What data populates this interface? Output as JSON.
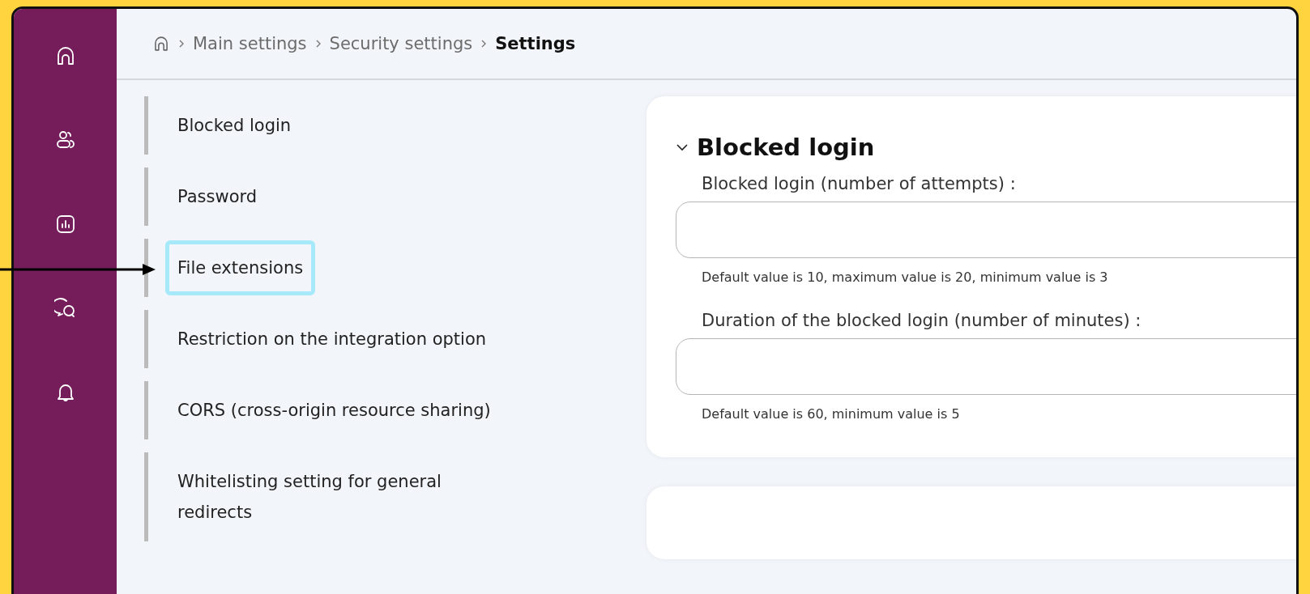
{
  "breadcrumb": [
    {
      "label": "Main settings",
      "current": false
    },
    {
      "label": "Security settings",
      "current": false
    },
    {
      "label": "Settings",
      "current": true
    }
  ],
  "nav": {
    "items": [
      {
        "label": "Blocked login",
        "highlighted": false
      },
      {
        "label": "Password",
        "highlighted": false
      },
      {
        "label": "File extensions",
        "highlighted": true
      },
      {
        "label": "Restriction on the integration option",
        "highlighted": false
      },
      {
        "label": "CORS (cross-origin resource sharing)",
        "highlighted": false
      },
      {
        "label": "Whitelisting setting for general redirects",
        "highlighted": false
      }
    ]
  },
  "section": {
    "title": "Blocked login",
    "expanded": true,
    "fields": [
      {
        "label": "Blocked login (number of attempts) :",
        "help": "Default value is 10, maximum value is 20, minimum value is 3"
      },
      {
        "label": "Duration of the blocked login (number of minutes) :",
        "help": "Default value is 60, minimum value is 5"
      }
    ]
  }
}
